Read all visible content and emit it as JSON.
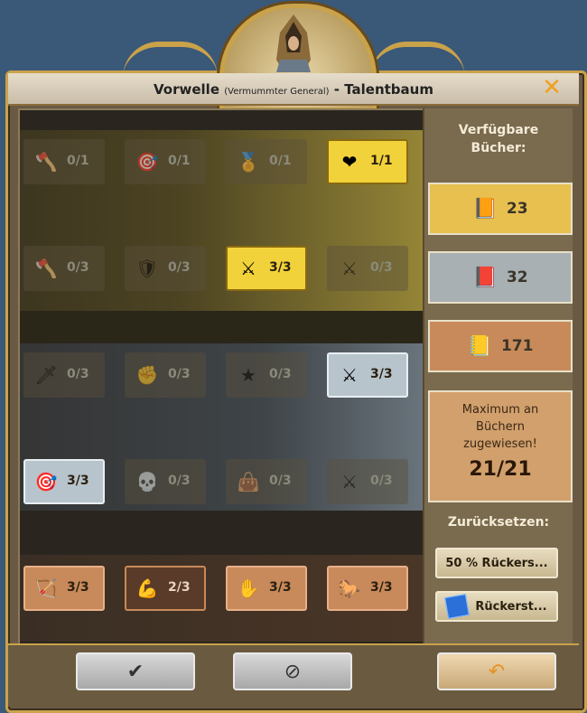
{
  "title": {
    "name": "Vorwelle",
    "subtitle": "(Vermummter General)",
    "suffix": "- Talentbaum"
  },
  "rows": [
    [
      {
        "icon": "axe-icon",
        "value": "0/1",
        "state": "off"
      },
      {
        "icon": "target-soldier-icon",
        "value": "0/1",
        "state": "off"
      },
      {
        "icon": "medal-plus-icon",
        "value": "0/1",
        "state": "off"
      },
      {
        "icon": "heart-icon",
        "value": "1/1",
        "state": "gold"
      }
    ],
    [
      {
        "icon": "axe-attack-icon",
        "value": "0/3",
        "state": "off"
      },
      {
        "icon": "horse-shield-icon",
        "value": "0/3",
        "state": "off"
      },
      {
        "icon": "swords-troops-icon",
        "value": "3/3",
        "state": "gold"
      },
      {
        "icon": "swords-clock-icon",
        "value": "0/3",
        "state": "off"
      }
    ],
    [
      {
        "icon": "shield-spear-icon",
        "value": "0/3",
        "state": "off"
      },
      {
        "icon": "fist-icon",
        "value": "0/3",
        "state": "off"
      },
      {
        "icon": "star-plus-icon",
        "value": "0/3",
        "state": "off"
      },
      {
        "icon": "swords-troops-icon",
        "value": "3/3",
        "state": "silver"
      }
    ],
    [
      {
        "icon": "bullseye-icon",
        "value": "3/3",
        "state": "silver"
      },
      {
        "icon": "skull-heart-icon",
        "value": "0/3",
        "state": "off"
      },
      {
        "icon": "bag-plus-icon",
        "value": "0/3",
        "state": "off"
      },
      {
        "icon": "swords-boot-icon",
        "value": "0/3",
        "state": "off"
      }
    ],
    [
      {
        "icon": "hunter-shield-icon",
        "value": "3/3",
        "state": "bronze"
      },
      {
        "icon": "strongman-icon",
        "value": "2/3",
        "state": "bronze2"
      },
      {
        "icon": "hand-heal-icon",
        "value": "3/3",
        "state": "bronze"
      },
      {
        "icon": "horse-icon",
        "value": "3/3",
        "state": "bronze"
      }
    ]
  ],
  "sidebar": {
    "heading": "Verfügbare Bücher:",
    "books": [
      {
        "icon": "gold-book-icon",
        "count": "23"
      },
      {
        "icon": "silver-book-icon",
        "count": "32"
      },
      {
        "icon": "bronze-book-icon",
        "count": "171"
      }
    ],
    "max_text": "Maximum an Büchern zugewiesen!",
    "assigned": "21/21",
    "reset_heading": "Zurücksetzen:",
    "reset_percent": "50 % Rückers...",
    "reset_gem": "Rückerst..."
  },
  "footer": {
    "confirm": "✔",
    "cancel": "⊘",
    "undo": "↶"
  },
  "colors": {
    "gold": "#f2d23a",
    "silver": "#b8c4cc",
    "bronze": "#c88a5a",
    "accent": "#c9a24a"
  }
}
